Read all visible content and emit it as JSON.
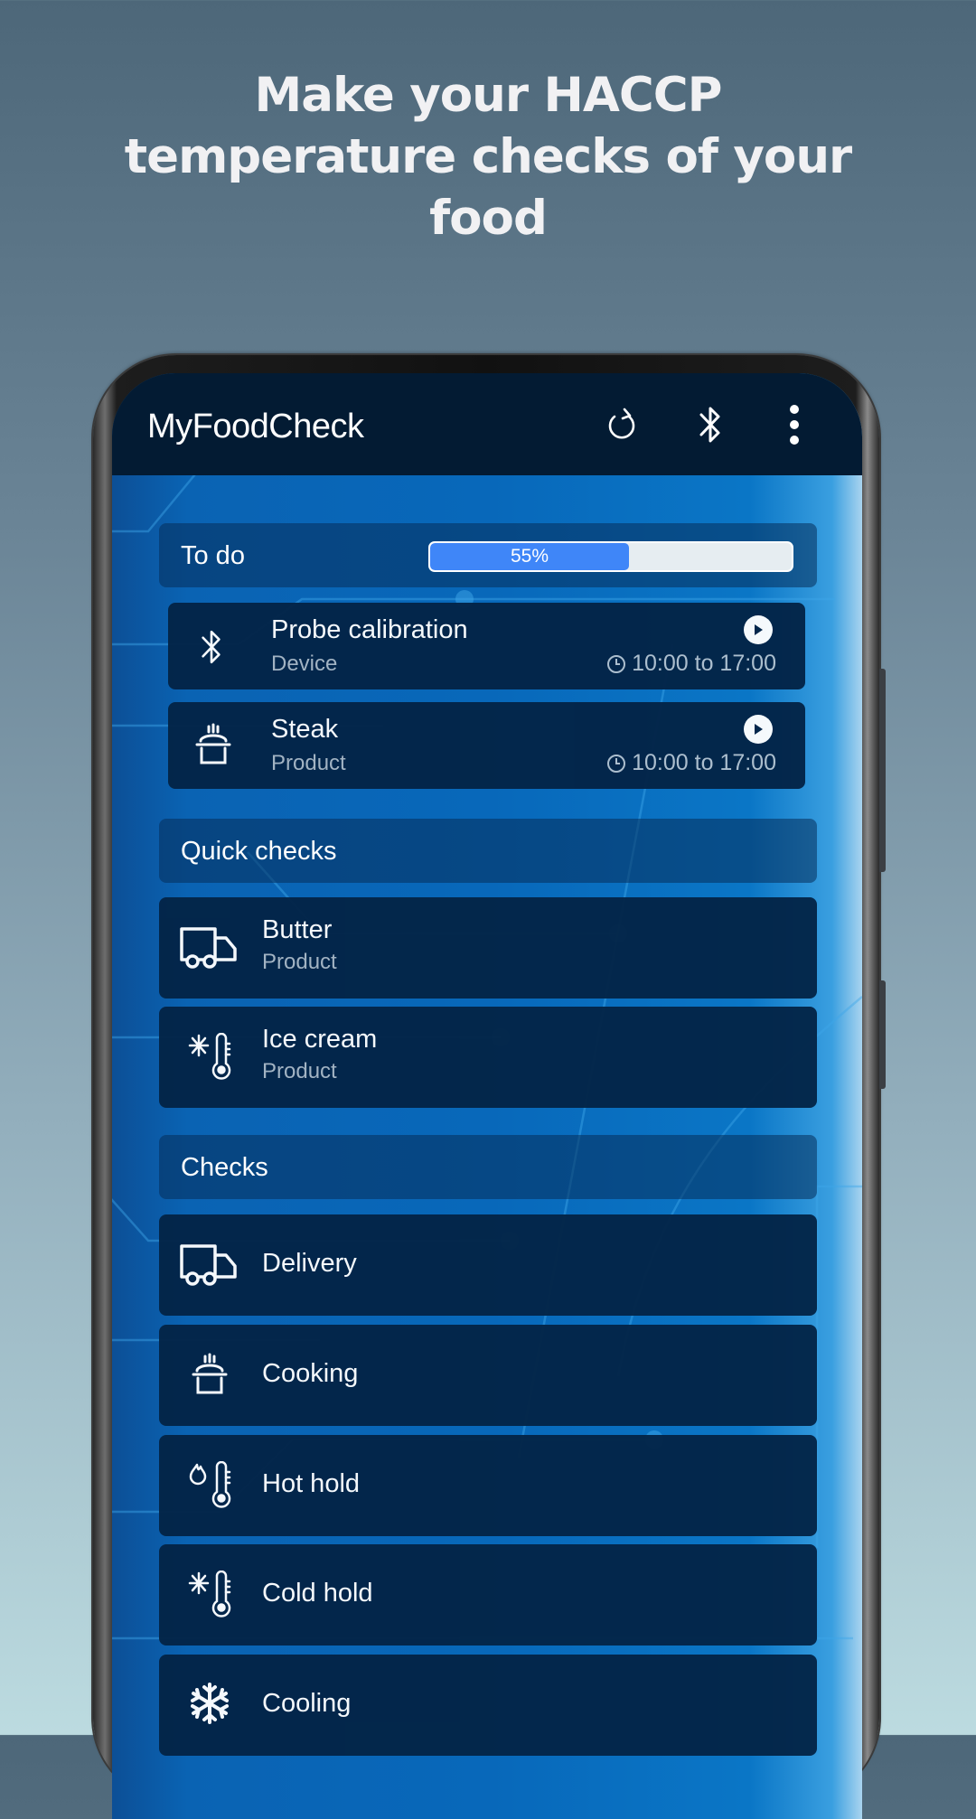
{
  "headline": {
    "line1": "Make your HACCP",
    "line2": "temperature checks of your",
    "line3": "food"
  },
  "app_bar": {
    "title": "MyFoodCheck",
    "actions": [
      {
        "icon": "refresh-icon",
        "label": "Refresh"
      },
      {
        "icon": "bluetooth-icon",
        "label": "Bluetooth"
      },
      {
        "icon": "more-vert-icon",
        "label": "More options"
      }
    ]
  },
  "todo": {
    "label": "To do",
    "progress_percent": 55,
    "progress_label": "55%",
    "items": [
      {
        "title": "Probe calibration",
        "subtitle": "Device",
        "icon": "bluetooth-icon",
        "time": "10:00 to 17:00",
        "action_icon": "play-icon"
      },
      {
        "title": "Steak",
        "subtitle": "Product",
        "icon": "cooking-pot-icon",
        "time": "10:00 to 17:00",
        "action_icon": "play-icon"
      }
    ]
  },
  "quick_checks": {
    "label": "Quick checks",
    "items": [
      {
        "title": "Butter",
        "subtitle": "Product",
        "icon": "delivery-truck-icon"
      },
      {
        "title": "Ice cream",
        "subtitle": "Product",
        "icon": "cold-thermometer-icon"
      }
    ]
  },
  "checks": {
    "label": "Checks",
    "items": [
      {
        "title": "Delivery",
        "icon": "delivery-truck-icon"
      },
      {
        "title": "Cooking",
        "icon": "cooking-pot-icon"
      },
      {
        "title": "Hot hold",
        "icon": "hot-thermometer-icon"
      },
      {
        "title": "Cold hold",
        "icon": "cold-thermometer-icon"
      },
      {
        "title": "Cooling",
        "icon": "snowflake-icon"
      }
    ]
  },
  "colors": {
    "app_bar": "#031b33",
    "card": "#032447",
    "progress_fill": "#3f86f8",
    "progress_track": "#e6edf1",
    "screen_blue": "#0868ba"
  }
}
